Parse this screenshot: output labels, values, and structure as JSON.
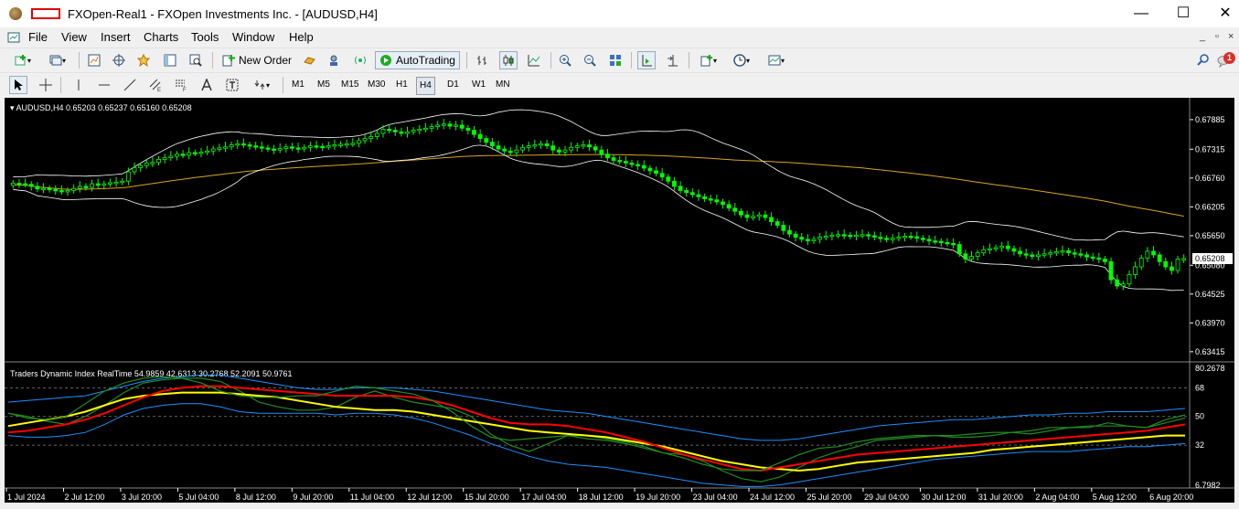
{
  "window": {
    "title": "FXOpen-Real1 - FXOpen Investments Inc. - [AUDUSD,H4]",
    "controls": {
      "minimize": "—",
      "maximize": "☐",
      "close": "✕"
    }
  },
  "menu": [
    "File",
    "View",
    "Insert",
    "Charts",
    "Tools",
    "Window",
    "Help"
  ],
  "mdi_controls": {
    "minimize": "_",
    "restore": "▫",
    "close": "×"
  },
  "toolbar": {
    "new_order_label": "New Order",
    "autotrading_label": "AutoTrading",
    "notification_count": "1"
  },
  "periods": [
    "M1",
    "M5",
    "M15",
    "M30",
    "H1",
    "H4",
    "D1",
    "W1",
    "MN"
  ],
  "active_period": "H4",
  "colors": {
    "chart_bg": "#000000",
    "bull_candle": "#00ff00",
    "bollinger": "#ffffff",
    "ma": "#daa520",
    "tdi_red": "#ff0000",
    "tdi_green": "#228b22",
    "tdi_yellow": "#ffff00",
    "tdi_blue": "#1e90ff",
    "grid_dash": "#808080"
  },
  "chart_data": [
    {
      "type": "candlestick",
      "title": "AUDUSD,H4  0.65203 0.65237 0.65160 0.65208",
      "ylim": [
        0.6336,
        0.68165
      ],
      "y_ticks": [
        "0.67885",
        "0.67315",
        "0.66760",
        "0.66205",
        "0.65650",
        "0.65080",
        "0.64525",
        "0.63970",
        "0.63415"
      ],
      "current_price": "0.65208",
      "close": [
        0.6666,
        0.6665,
        0.6664,
        0.666,
        0.6655,
        0.6656,
        0.6654,
        0.6652,
        0.665,
        0.6652,
        0.6656,
        0.666,
        0.6658,
        0.6665,
        0.6662,
        0.6665,
        0.6667,
        0.6668,
        0.667,
        0.6688,
        0.6696,
        0.67,
        0.6705,
        0.6706,
        0.6712,
        0.6715,
        0.6718,
        0.6722,
        0.672,
        0.6725,
        0.6724,
        0.6726,
        0.6728,
        0.6732,
        0.6734,
        0.6736,
        0.674,
        0.6742,
        0.674,
        0.6738,
        0.6736,
        0.6734,
        0.6732,
        0.673,
        0.6733,
        0.6736,
        0.6734,
        0.6732,
        0.6735,
        0.6738,
        0.6737,
        0.6736,
        0.6738,
        0.674,
        0.6741,
        0.6742,
        0.6743,
        0.6748,
        0.6752,
        0.6756,
        0.6762,
        0.677,
        0.6768,
        0.6765,
        0.6762,
        0.6765,
        0.6768,
        0.677,
        0.6772,
        0.6775,
        0.6778,
        0.678,
        0.6776,
        0.6778,
        0.6772,
        0.6768,
        0.676,
        0.6752,
        0.6745,
        0.6738,
        0.6732,
        0.6728,
        0.6725,
        0.673,
        0.6735,
        0.6738,
        0.674,
        0.6742,
        0.6738,
        0.673,
        0.6726,
        0.673,
        0.6735,
        0.6738,
        0.674,
        0.6736,
        0.673,
        0.6722,
        0.6715,
        0.671,
        0.6708,
        0.6705,
        0.6702,
        0.67,
        0.6695,
        0.669,
        0.6685,
        0.6678,
        0.667,
        0.666,
        0.6652,
        0.6648,
        0.6644,
        0.664,
        0.6636,
        0.6634,
        0.663,
        0.6625,
        0.6618,
        0.6612,
        0.6605,
        0.66,
        0.6602,
        0.6605,
        0.66,
        0.6592,
        0.6585,
        0.6575,
        0.6568,
        0.6562,
        0.6558,
        0.6555,
        0.6558,
        0.6562,
        0.6564,
        0.6566,
        0.6567,
        0.6566,
        0.6564,
        0.6566,
        0.6567,
        0.6565,
        0.6562,
        0.656,
        0.6558,
        0.656,
        0.6562,
        0.6564,
        0.6563,
        0.656,
        0.6558,
        0.6555,
        0.6554,
        0.6552,
        0.655,
        0.6548,
        0.653,
        0.652,
        0.6525,
        0.6532,
        0.6538,
        0.654,
        0.6542,
        0.6545,
        0.654,
        0.6535,
        0.653,
        0.6528,
        0.6525,
        0.6528,
        0.653,
        0.6532,
        0.6534,
        0.6536,
        0.6532,
        0.653,
        0.6528,
        0.6524,
        0.6522,
        0.652,
        0.6515,
        0.648,
        0.6468,
        0.6472,
        0.649,
        0.6505,
        0.6522,
        0.6535,
        0.6528,
        0.6515,
        0.6505,
        0.6498,
        0.652,
        0.6521
      ],
      "x_labels": [
        "1 Jul 2024",
        "2 Jul 12:00",
        "3 Jul 20:00",
        "5 Jul 04:00",
        "8 Jul 12:00",
        "9 Jul 20:00",
        "11 Jul 04:00",
        "12 Jul 12:00",
        "15 Jul 20:00",
        "17 Jul 04:00",
        "18 Jul 12:00",
        "19 Jul 20:00",
        "23 Jul 04:00",
        "24 Jul 12:00",
        "25 Jul 20:00",
        "29 Jul 04:00",
        "30 Jul 12:00",
        "31 Jul 20:00",
        "2 Aug 04:00",
        "5 Aug 12:00",
        "6 Aug 20:00"
      ]
    },
    {
      "type": "line",
      "title": "Traders Dynamic Index RealTime 54.9859 42.6313 30.2768 52.2091 50.9761",
      "ylim": [
        6.7982,
        80.2678
      ],
      "y_ticks": [
        "80.2678",
        "68",
        "50",
        "32",
        "6.7982"
      ],
      "levels": [
        68,
        50,
        32
      ],
      "series": [
        {
          "name": "",
          "values": [
            52,
            50,
            47,
            45,
            50,
            57,
            65,
            71,
            73,
            74,
            74,
            72,
            66,
            59,
            56,
            54,
            54,
            56,
            62,
            66,
            62,
            59,
            57,
            55,
            50,
            39,
            32,
            28,
            33,
            38,
            38,
            36,
            34,
            31,
            27,
            26,
            22,
            16,
            11,
            9,
            12,
            18,
            24,
            28,
            31,
            35,
            36,
            37,
            38,
            37,
            37,
            38,
            40,
            39,
            41,
            43,
            43,
            46,
            44,
            43,
            48,
            51
          ]
        },
        {
          "name": "",
          "values": [
            44,
            46,
            48,
            50,
            53,
            57,
            61,
            63,
            64,
            65,
            65,
            65,
            64,
            63,
            62,
            60,
            58,
            56,
            55,
            54,
            54,
            53,
            51,
            49,
            47,
            45,
            43,
            41,
            40,
            39,
            38,
            37,
            35,
            33,
            31,
            28,
            25,
            22,
            20,
            18,
            17,
            16,
            17,
            19,
            21,
            22,
            23,
            24,
            25,
            26,
            27,
            29,
            30,
            31,
            32,
            33,
            34,
            35,
            36,
            37,
            38,
            38
          ]
        },
        {
          "name": "",
          "values": [
            40,
            41,
            43,
            45,
            48,
            52,
            57,
            62,
            66,
            68,
            69,
            69,
            68,
            67,
            66,
            65,
            64,
            63,
            63,
            63,
            63,
            62,
            60,
            57,
            53,
            49,
            46,
            45,
            45,
            44,
            42,
            40,
            37,
            34,
            30,
            26,
            23,
            20,
            17,
            16,
            18,
            20,
            22,
            24,
            26,
            27,
            28,
            29,
            30,
            31,
            32,
            33,
            34,
            35,
            36,
            37,
            38,
            39,
            40,
            41,
            43,
            45
          ]
        },
        {
          "name": "",
          "values": [
            52,
            49,
            48,
            50,
            58,
            66,
            71,
            74,
            75,
            74,
            71,
            66,
            63,
            62,
            62,
            63,
            63,
            66,
            69,
            68,
            66,
            64,
            60,
            53,
            44,
            37,
            35,
            36,
            37,
            38,
            36,
            35,
            33,
            30,
            27,
            24,
            20,
            17,
            16,
            16,
            21,
            26,
            30,
            31,
            34,
            36,
            37,
            38,
            38,
            38,
            39,
            40,
            40,
            41,
            43,
            43,
            44,
            44,
            44,
            43,
            46,
            49
          ]
        }
      ],
      "upper_band": [
        59,
        60,
        61,
        62,
        63,
        66,
        69,
        72,
        74,
        75,
        76,
        76,
        74,
        72,
        70,
        68,
        67,
        67,
        68,
        68,
        68,
        67,
        66,
        64,
        62,
        60,
        58,
        56,
        54,
        53,
        52,
        50,
        48,
        46,
        44,
        42,
        40,
        38,
        36,
        35,
        35,
        36,
        38,
        40,
        42,
        44,
        45,
        46,
        47,
        48,
        48,
        49,
        50,
        51,
        51,
        52,
        52,
        53,
        53,
        53,
        54,
        55
      ],
      "lower_band": [
        38,
        37,
        37,
        38,
        40,
        45,
        51,
        55,
        57,
        58,
        58,
        56,
        53,
        52,
        52,
        52,
        52,
        51,
        52,
        52,
        51,
        49,
        46,
        42,
        38,
        33,
        29,
        25,
        22,
        20,
        19,
        18,
        16,
        14,
        12,
        10,
        8,
        7,
        6,
        6,
        7,
        9,
        11,
        13,
        15,
        17,
        19,
        21,
        23,
        24,
        25,
        26,
        27,
        28,
        28,
        28,
        29,
        30,
        31,
        31,
        32,
        33
      ],
      "x_labels": [
        "1 Jul 2024",
        "2 Jul 12:00",
        "3 Jul 20:00",
        "5 Jul 04:00",
        "8 Jul 12:00",
        "9 Jul 20:00",
        "11 Jul 04:00",
        "12 Jul 12:00",
        "15 Jul 20:00",
        "17 Jul 04:00",
        "18 Jul 12:00",
        "19 Jul 20:00",
        "23 Jul 04:00",
        "24 Jul 12:00",
        "25 Jul 20:00",
        "29 Jul 04:00",
        "30 Jul 12:00",
        "31 Jul 20:00",
        "2 Aug 04:00",
        "5 Aug 12:00",
        "6 Aug 20:00"
      ]
    }
  ]
}
